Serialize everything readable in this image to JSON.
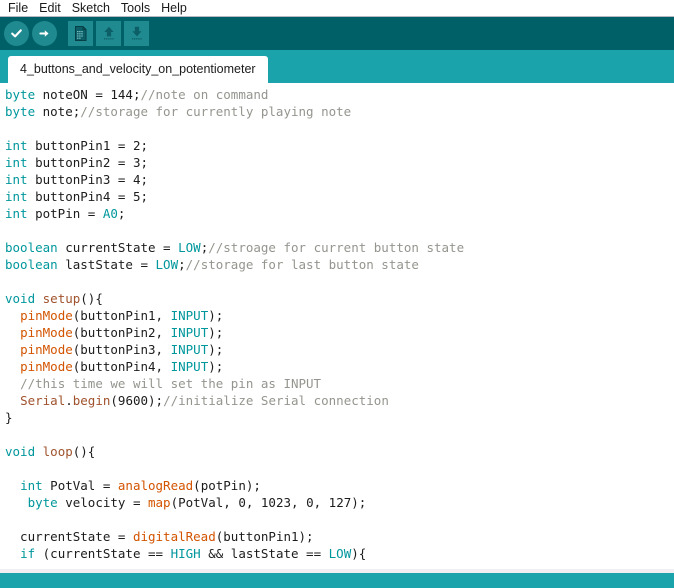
{
  "app": {
    "name": "Arduino IDE",
    "theme": {
      "toolbar_bg": "#006068",
      "tabbar_bg": "#1ba3ab",
      "button_bg": "#1f8a90",
      "editor_bg": "#ffffff",
      "keyword": "#00979c",
      "function": "#d35400",
      "function_alt": "#a0522d",
      "comment": "#95958f",
      "text": "#1c1c1c"
    }
  },
  "menubar": {
    "items": [
      {
        "label": "File"
      },
      {
        "label": "Edit"
      },
      {
        "label": "Sketch"
      },
      {
        "label": "Tools"
      },
      {
        "label": "Help"
      }
    ]
  },
  "toolbar": {
    "buttons": [
      {
        "name": "verify-button",
        "icon": "check-icon",
        "tooltip": "Verify"
      },
      {
        "name": "upload-button",
        "icon": "arrow-right-icon",
        "tooltip": "Upload"
      },
      {
        "name": "new-button",
        "icon": "document-icon",
        "tooltip": "New"
      },
      {
        "name": "open-button",
        "icon": "arrow-up-icon",
        "tooltip": "Open"
      },
      {
        "name": "save-button",
        "icon": "arrow-down-icon",
        "tooltip": "Save"
      }
    ]
  },
  "tabs": {
    "active_index": 0,
    "items": [
      {
        "label": "4_buttons_and_velocity_on_potentiometer"
      }
    ]
  },
  "editor": {
    "lines": [
      [
        {
          "t": "byte",
          "c": "kw"
        },
        {
          "t": " noteON = ",
          "c": "plain"
        },
        {
          "t": "144",
          "c": "num"
        },
        {
          "t": ";",
          "c": "plain"
        },
        {
          "t": "//note on command",
          "c": "com"
        }
      ],
      [
        {
          "t": "byte",
          "c": "kw"
        },
        {
          "t": " note;",
          "c": "plain"
        },
        {
          "t": "//storage for currently playing note",
          "c": "com"
        }
      ],
      [],
      [
        {
          "t": "int",
          "c": "kw"
        },
        {
          "t": " buttonPin1 = ",
          "c": "plain"
        },
        {
          "t": "2",
          "c": "num"
        },
        {
          "t": ";",
          "c": "plain"
        }
      ],
      [
        {
          "t": "int",
          "c": "kw"
        },
        {
          "t": " buttonPin2 = ",
          "c": "plain"
        },
        {
          "t": "3",
          "c": "num"
        },
        {
          "t": ";",
          "c": "plain"
        }
      ],
      [
        {
          "t": "int",
          "c": "kw"
        },
        {
          "t": " buttonPin3 = ",
          "c": "plain"
        },
        {
          "t": "4",
          "c": "num"
        },
        {
          "t": ";",
          "c": "plain"
        }
      ],
      [
        {
          "t": "int",
          "c": "kw"
        },
        {
          "t": " buttonPin4 = ",
          "c": "plain"
        },
        {
          "t": "5",
          "c": "num"
        },
        {
          "t": ";",
          "c": "plain"
        }
      ],
      [
        {
          "t": "int",
          "c": "kw"
        },
        {
          "t": " potPin = ",
          "c": "plain"
        },
        {
          "t": "A0",
          "c": "const"
        },
        {
          "t": ";",
          "c": "plain"
        }
      ],
      [],
      [
        {
          "t": "boolean",
          "c": "kw"
        },
        {
          "t": " currentState = ",
          "c": "plain"
        },
        {
          "t": "LOW",
          "c": "const"
        },
        {
          "t": ";",
          "c": "plain"
        },
        {
          "t": "//stroage for current button state",
          "c": "com"
        }
      ],
      [
        {
          "t": "boolean",
          "c": "kw"
        },
        {
          "t": " lastState = ",
          "c": "plain"
        },
        {
          "t": "LOW",
          "c": "const"
        },
        {
          "t": ";",
          "c": "plain"
        },
        {
          "t": "//storage for last button state",
          "c": "com"
        }
      ],
      [],
      [
        {
          "t": "void",
          "c": "kw"
        },
        {
          "t": " ",
          "c": "plain"
        },
        {
          "t": "setup",
          "c": "fn2"
        },
        {
          "t": "(){",
          "c": "plain"
        }
      ],
      [
        {
          "t": "  ",
          "c": "plain"
        },
        {
          "t": "pinMode",
          "c": "fn"
        },
        {
          "t": "(buttonPin1, ",
          "c": "plain"
        },
        {
          "t": "INPUT",
          "c": "const"
        },
        {
          "t": ");",
          "c": "plain"
        }
      ],
      [
        {
          "t": "  ",
          "c": "plain"
        },
        {
          "t": "pinMode",
          "c": "fn"
        },
        {
          "t": "(buttonPin2, ",
          "c": "plain"
        },
        {
          "t": "INPUT",
          "c": "const"
        },
        {
          "t": ");",
          "c": "plain"
        }
      ],
      [
        {
          "t": "  ",
          "c": "plain"
        },
        {
          "t": "pinMode",
          "c": "fn"
        },
        {
          "t": "(buttonPin3, ",
          "c": "plain"
        },
        {
          "t": "INPUT",
          "c": "const"
        },
        {
          "t": ");",
          "c": "plain"
        }
      ],
      [
        {
          "t": "  ",
          "c": "plain"
        },
        {
          "t": "pinMode",
          "c": "fn"
        },
        {
          "t": "(buttonPin4, ",
          "c": "plain"
        },
        {
          "t": "INPUT",
          "c": "const"
        },
        {
          "t": ");",
          "c": "plain"
        }
      ],
      [
        {
          "t": "  ",
          "c": "plain"
        },
        {
          "t": "//this time we will set the pin as INPUT",
          "c": "com"
        }
      ],
      [
        {
          "t": "  ",
          "c": "plain"
        },
        {
          "t": "Serial",
          "c": "fn2"
        },
        {
          "t": ".",
          "c": "plain"
        },
        {
          "t": "begin",
          "c": "fn2"
        },
        {
          "t": "(",
          "c": "plain"
        },
        {
          "t": "9600",
          "c": "num"
        },
        {
          "t": ");",
          "c": "plain"
        },
        {
          "t": "//initialize Serial connection",
          "c": "com"
        }
      ],
      [
        {
          "t": "}",
          "c": "plain"
        }
      ],
      [],
      [
        {
          "t": "void",
          "c": "kw"
        },
        {
          "t": " ",
          "c": "plain"
        },
        {
          "t": "loop",
          "c": "fn2"
        },
        {
          "t": "(){",
          "c": "plain"
        }
      ],
      [],
      [
        {
          "t": "  ",
          "c": "plain"
        },
        {
          "t": "int",
          "c": "kw"
        },
        {
          "t": " PotVal = ",
          "c": "plain"
        },
        {
          "t": "analogRead",
          "c": "fn"
        },
        {
          "t": "(potPin);",
          "c": "plain"
        }
      ],
      [
        {
          "t": "   ",
          "c": "plain"
        },
        {
          "t": "byte",
          "c": "kw"
        },
        {
          "t": " velocity = ",
          "c": "plain"
        },
        {
          "t": "map",
          "c": "fn"
        },
        {
          "t": "(PotVal, ",
          "c": "plain"
        },
        {
          "t": "0",
          "c": "num"
        },
        {
          "t": ", ",
          "c": "plain"
        },
        {
          "t": "1023",
          "c": "num"
        },
        {
          "t": ", ",
          "c": "plain"
        },
        {
          "t": "0",
          "c": "num"
        },
        {
          "t": ", ",
          "c": "plain"
        },
        {
          "t": "127",
          "c": "num"
        },
        {
          "t": ");",
          "c": "plain"
        }
      ],
      [],
      [
        {
          "t": "  currentState = ",
          "c": "plain"
        },
        {
          "t": "digitalRead",
          "c": "fn"
        },
        {
          "t": "(buttonPin1);",
          "c": "plain"
        }
      ],
      [
        {
          "t": "  ",
          "c": "plain"
        },
        {
          "t": "if",
          "c": "kw"
        },
        {
          "t": " (currentState == ",
          "c": "plain"
        },
        {
          "t": "HIGH",
          "c": "const"
        },
        {
          "t": " && lastState == ",
          "c": "plain"
        },
        {
          "t": "LOW",
          "c": "const"
        },
        {
          "t": "){",
          "c": "plain"
        }
      ]
    ]
  },
  "statusbar": {
    "message": ""
  }
}
